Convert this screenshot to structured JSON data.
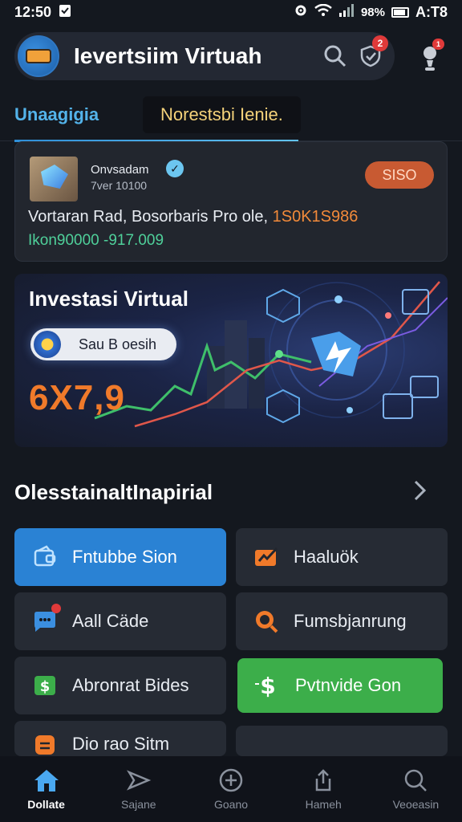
{
  "status_bar": {
    "time": "12:50",
    "battery": "98%",
    "right_text": "A:T8"
  },
  "header": {
    "title": "Ievertsiim Virtuah",
    "notification_count": "2",
    "profile_badge": "1"
  },
  "tabs": [
    {
      "label": "Unaagigia"
    },
    {
      "label": "Norestsbi Ienie."
    }
  ],
  "notification": {
    "name": "Onvsadam",
    "subtitle": "7ver 10100",
    "chip": "SISO",
    "line1_main": "Vortaran Rad, Bosorbaris Pro ole, ",
    "line1_accent": "1S0K1S986",
    "line2": "Ikon90000 -917.009"
  },
  "hero": {
    "title": "Investasi Virtual",
    "pill_label": "Sau B oesih",
    "value": "6X7,9"
  },
  "section": {
    "title": "OlesstainaltInapirial"
  },
  "grid": [
    {
      "label": "Fntubbe Sion",
      "icon": "wallet-icon"
    },
    {
      "label": "Haaluök",
      "icon": "chart-check-icon"
    },
    {
      "label": "Aall Cäde",
      "icon": "chat-icon"
    },
    {
      "label": "Fumsbjanrung",
      "icon": "search-coin-icon"
    },
    {
      "label": "Abronrat Bides",
      "icon": "money-icon"
    },
    {
      "label": "Pvtnvide Gon",
      "icon": "dollar-icon"
    },
    {
      "label": "Dio rao Sitm",
      "icon": "document-icon"
    }
  ],
  "bottom_nav": [
    {
      "label": "Dollate",
      "icon": "home-icon"
    },
    {
      "label": "Sajane",
      "icon": "send-icon"
    },
    {
      "label": "Goano",
      "icon": "add-circle-icon"
    },
    {
      "label": "Hameh",
      "icon": "share-icon"
    },
    {
      "label": "Veoeasin",
      "icon": "search-icon"
    }
  ],
  "colors": {
    "accent_blue": "#2a82d4",
    "accent_green": "#3cae4a",
    "accent_orange": "#f07a2a",
    "background": "#14181f"
  }
}
